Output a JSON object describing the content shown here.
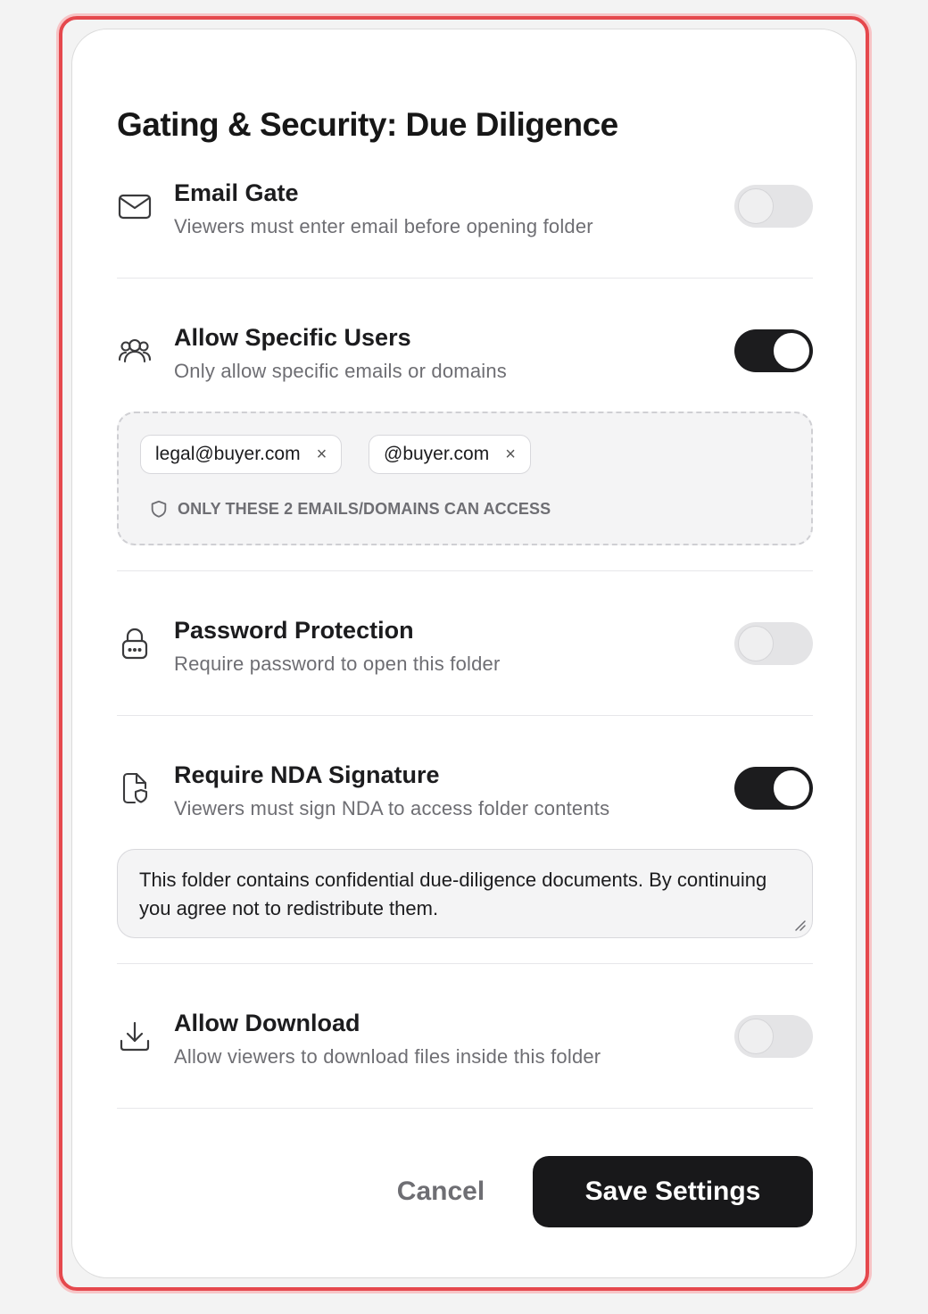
{
  "modal": {
    "title": "Gating & Security: Due Diligence"
  },
  "settings": {
    "email_gate": {
      "label": "Email Gate",
      "description": "Viewers must enter email before opening folder",
      "enabled": false,
      "icon": "mail-icon"
    },
    "allow_specific_users": {
      "label": "Allow Specific Users",
      "description": "Only allow specific emails or domains",
      "enabled": true,
      "icon": "users-icon",
      "tags": [
        "legal@buyer.com",
        "@buyer.com"
      ],
      "remove_glyph": "×",
      "access_note": "ONLY THESE 2 EMAILS/DOMAINS CAN ACCESS"
    },
    "password_protection": {
      "label": "Password Protection",
      "description": "Require password to open this folder",
      "enabled": false,
      "icon": "lock-icon"
    },
    "require_nda": {
      "label": "Require NDA Signature",
      "description": "Viewers must sign NDA to access folder contents",
      "enabled": true,
      "icon": "document-shield-icon",
      "nda_text": "This folder contains confidential due-diligence documents. By continuing you agree not to redistribute them."
    },
    "allow_download": {
      "label": "Allow Download",
      "description": "Allow viewers to download files inside this folder",
      "enabled": false,
      "icon": "download-icon"
    }
  },
  "actions": {
    "cancel_label": "Cancel",
    "save_label": "Save Settings"
  },
  "colors": {
    "frame_border": "#e5484d",
    "toggle_on": "#1c1c1e",
    "toggle_off": "#e4e4e6",
    "primary_button": "#18181a"
  }
}
